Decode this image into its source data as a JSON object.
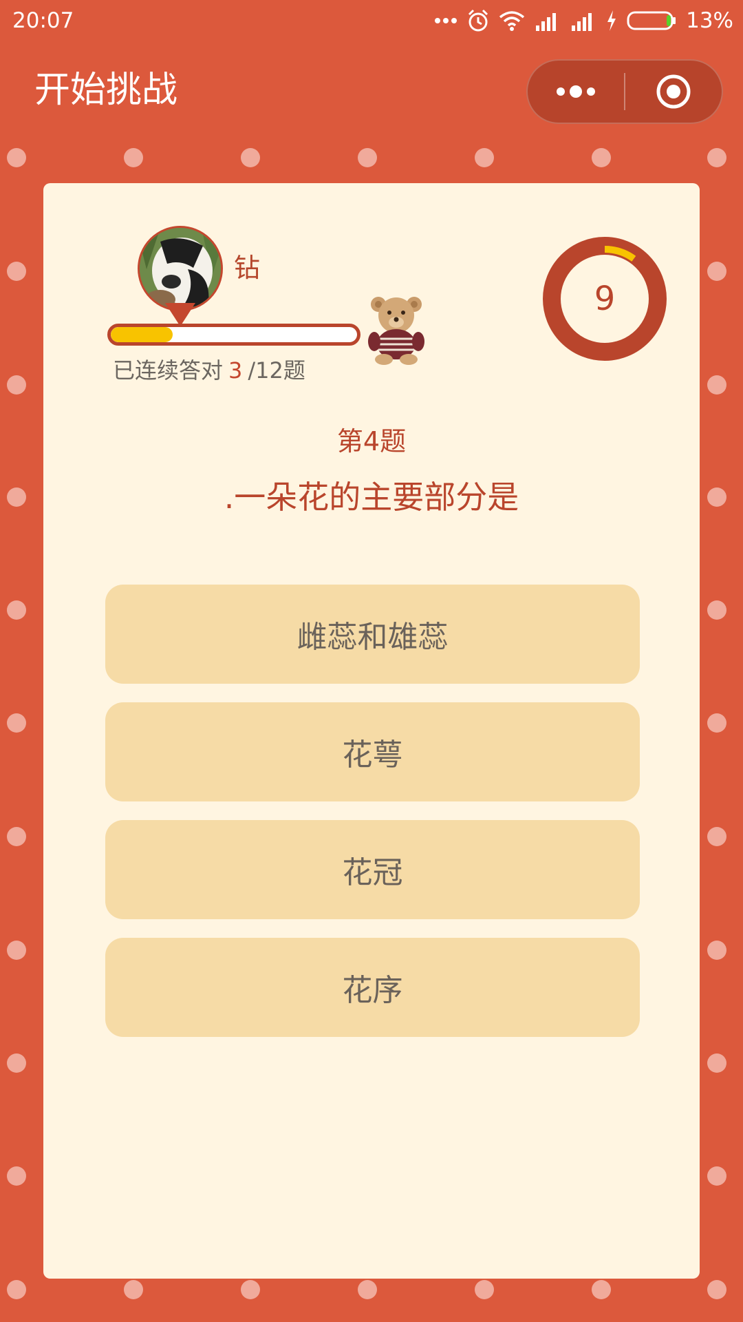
{
  "status_bar": {
    "time": "20:07",
    "battery_percent": "13%",
    "icons": [
      "more-dots-icon",
      "alarm-icon",
      "wifi-icon",
      "signal-icon",
      "signal-icon",
      "charging-icon",
      "battery-icon"
    ]
  },
  "header": {
    "title": "开始挑战",
    "menu_icon": "more-dots-icon",
    "close_icon": "target-close-icon"
  },
  "player": {
    "name": "钻",
    "avatar_icon": "panda-avatar",
    "streak_prefix": "已连续答对",
    "streak_count": "3",
    "streak_suffix": "/12题",
    "progress_fraction": 0.25,
    "mascot_icon": "teddy-bear-icon"
  },
  "timer": {
    "value": "9",
    "remaining_fraction": 0.1
  },
  "question": {
    "number_label": "第4题",
    "text": ".一朵花的主要部分是"
  },
  "answers": [
    {
      "label": "雌蕊和雄蕊"
    },
    {
      "label": "花萼"
    },
    {
      "label": "花冠"
    },
    {
      "label": "花序"
    }
  ],
  "colors": {
    "background": "#dc593c",
    "card": "#fff5e1",
    "accent": "#b9452c",
    "answer_button": "#f6dba6",
    "progress": "#f8c300"
  }
}
